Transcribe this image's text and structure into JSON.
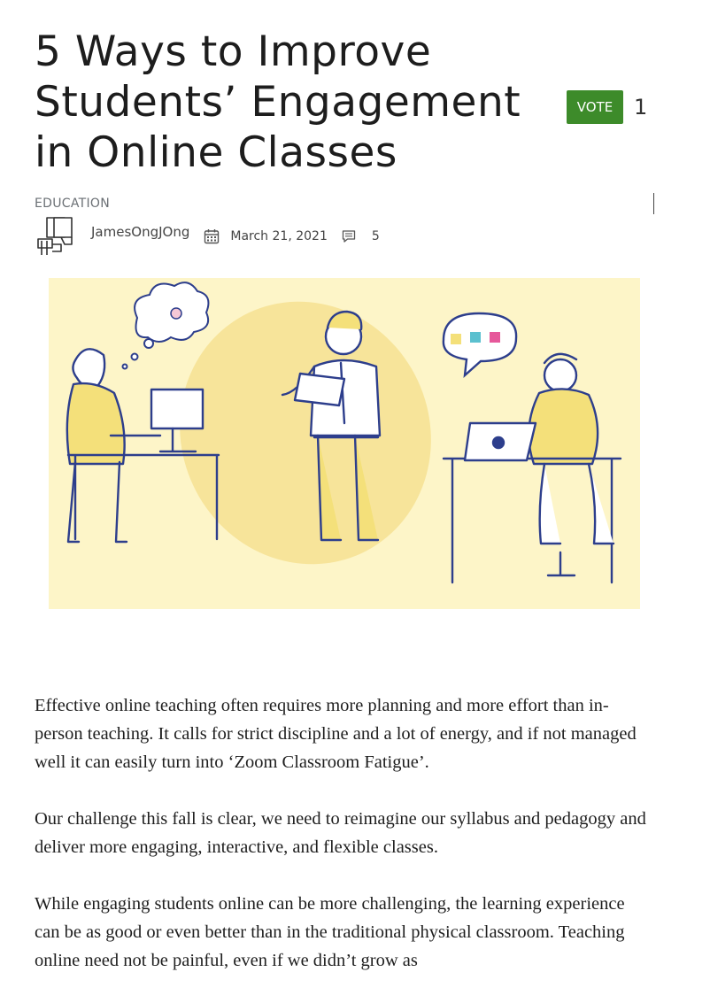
{
  "article": {
    "title": "5 Ways to Improve Students’ Engagement in Online Classes",
    "category": "EDUCATION",
    "author": "JamesOngJOng",
    "date": "March 21, 2021",
    "comment_count": "5"
  },
  "vote": {
    "label": "VOTE",
    "count": "1"
  },
  "body": {
    "paragraphs": [
      "Effective online teaching often requires more planning and more effort than in-person teaching. It calls for strict discipline and a lot of energy, and if not managed well it can easily turn into ‘Zoom Classroom Fatigue’.",
      "Our challenge this fall is clear, we need to reimagine our syllabus and pedagogy and deliver more engaging, interactive, and flexible classes.",
      "While engaging students online can be more challenging, the learning experience can be  as good or even better than in the traditional physical classroom.  Teaching online need not be painful, even if we didn’t grow as"
    ]
  },
  "colors": {
    "vote_bg": "#3d8b2a",
    "hero_bg": "#fdf5c8",
    "ink": "#2d3e8c",
    "accent_yellow": "#f4e07a"
  }
}
